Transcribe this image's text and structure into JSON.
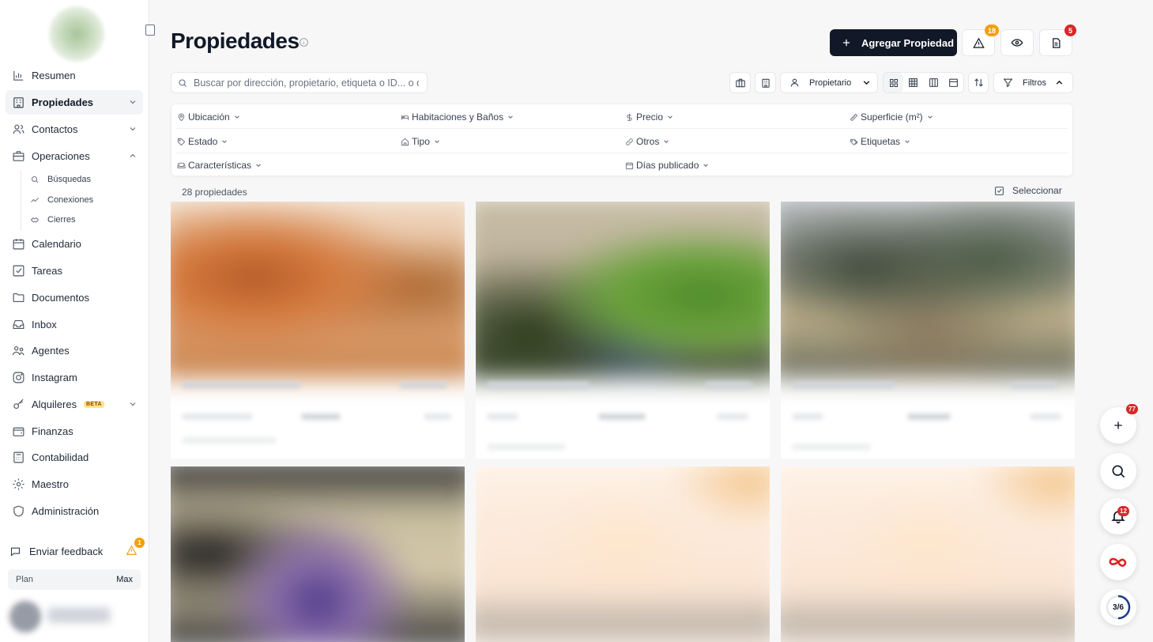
{
  "sidebar": {
    "nav": [
      {
        "label": "Resumen",
        "icon": "chart-bar-icon"
      },
      {
        "label": "Propiedades",
        "icon": "building-icon",
        "active": true
      },
      {
        "label": "Contactos",
        "icon": "users-icon"
      },
      {
        "label": "Operaciones",
        "icon": "briefcase-icon",
        "expanded": true
      },
      {
        "label": "Calendario",
        "icon": "calendar-icon"
      },
      {
        "label": "Tareas",
        "icon": "checkbox-icon"
      },
      {
        "label": "Documentos",
        "icon": "folder-icon"
      },
      {
        "label": "Inbox",
        "icon": "inbox-icon"
      },
      {
        "label": "Agentes",
        "icon": "user-group-icon"
      },
      {
        "label": "Instagram",
        "icon": "instagram-icon"
      },
      {
        "label": "Alquileres",
        "icon": "key-icon",
        "badge": "BETA"
      },
      {
        "label": "Finanzas",
        "icon": "wallet-icon"
      },
      {
        "label": "Contabilidad",
        "icon": "calculator-icon"
      },
      {
        "label": "Maestro",
        "icon": "gear-icon"
      },
      {
        "label": "Administración",
        "icon": "shield-icon"
      }
    ],
    "operaciones_sub": [
      {
        "label": "Búsquedas",
        "icon": "search-icon"
      },
      {
        "label": "Conexiones",
        "icon": "trend-icon"
      },
      {
        "label": "Cierres",
        "icon": "handshake-icon"
      }
    ],
    "feedback": {
      "label": "Enviar feedback",
      "badge": "1"
    },
    "plan": {
      "label": "Plan",
      "value": "Max"
    }
  },
  "header": {
    "title": "Propiedades",
    "add_label": "Agregar Propiedad",
    "alerts_badge": "18",
    "docs_badge": "5"
  },
  "toolbar": {
    "search_placeholder": "Buscar por dirección, propietario, etiqueta o ID... o c",
    "owner_label": "Propietario",
    "filters_label": "Filtros"
  },
  "filters": [
    {
      "label": "Ubicación",
      "icon": "pin-icon"
    },
    {
      "label": "Habitaciones y Baños",
      "icon": "bed-icon"
    },
    {
      "label": "Precio",
      "icon": "dollar-icon"
    },
    {
      "label": "Superficie (m²)",
      "icon": "ruler-icon"
    },
    {
      "label": "Estado",
      "icon": "tag-icon"
    },
    {
      "label": "Tipo",
      "icon": "home-icon"
    },
    {
      "label": "Otros",
      "icon": "link-icon"
    },
    {
      "label": "Etiquetas",
      "icon": "tags-icon"
    },
    {
      "label": "Características",
      "icon": "sofa-icon"
    },
    {
      "label": "Días publicado",
      "icon": "calendar-icon"
    }
  ],
  "results": {
    "count": "28 propiedades",
    "select_label": "Seleccionar"
  },
  "fabs": {
    "add_badge": "77",
    "notif_badge": "12",
    "progress": "3/6"
  },
  "colors": {
    "primary": "#111827",
    "accent_orange": "#f59e0b",
    "danger": "#dc2626"
  }
}
